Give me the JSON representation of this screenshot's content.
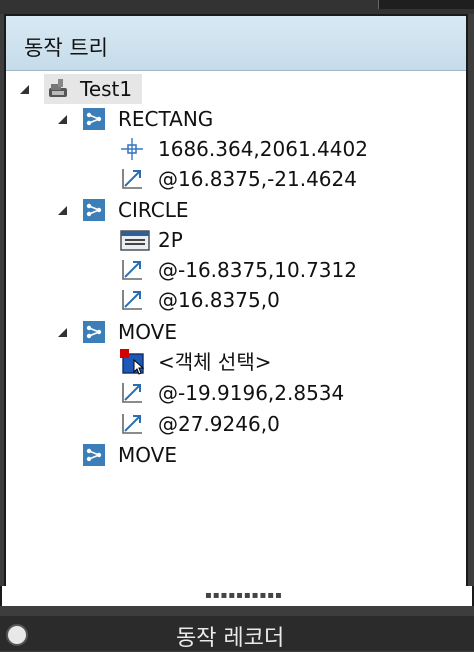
{
  "panel": {
    "title": "동작 트리"
  },
  "tree": {
    "root": {
      "label": "Test1"
    },
    "commands": [
      {
        "label": "RECTANG",
        "children": [
          {
            "icon": "point-icon",
            "label": "1686.364,2061.4402"
          },
          {
            "icon": "relative-vector-icon",
            "label": "@16.8375,-21.4624"
          }
        ]
      },
      {
        "label": "CIRCLE",
        "children": [
          {
            "icon": "option-icon",
            "label": "2P"
          },
          {
            "icon": "relative-vector-icon",
            "label": "@-16.8375,10.7312"
          },
          {
            "icon": "relative-vector-icon",
            "label": "@16.8375,0"
          }
        ]
      },
      {
        "label": "MOVE",
        "children": [
          {
            "icon": "select-objects-icon",
            "label": "<객체 선택>"
          },
          {
            "icon": "relative-vector-icon",
            "label": "@-19.9196,2.8534"
          },
          {
            "icon": "relative-vector-icon",
            "label": "@27.9246,0"
          }
        ]
      },
      {
        "label": "MOVE",
        "children": []
      }
    ]
  },
  "bottom": {
    "title": "동작 레코더"
  },
  "colors": {
    "header": "#cfe3ef",
    "command_icon": "#3c7fb8",
    "vector_icon": "#2a6db0",
    "selection_marker": "#d40000"
  }
}
